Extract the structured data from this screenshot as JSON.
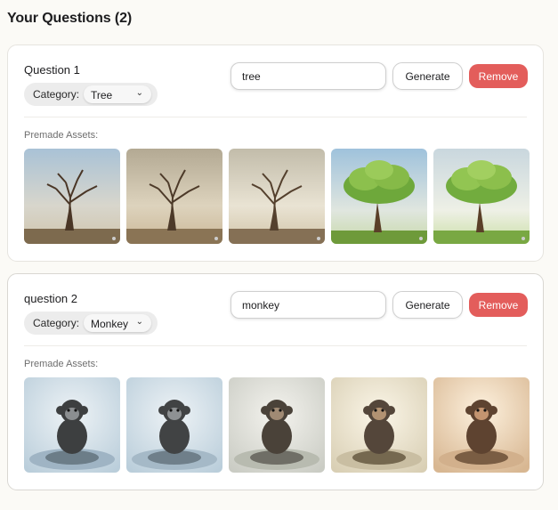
{
  "page": {
    "title": "Your Questions (2)"
  },
  "questions": [
    {
      "title": "Question 1",
      "category_label": "Category:",
      "category_value": "Tree",
      "prompt_value": "tree",
      "generate_label": "Generate",
      "remove_label": "Remove",
      "assets_label": "Premade Assets:",
      "assets": [
        {
          "name": "bare-tree-blue-sky"
        },
        {
          "name": "bare-tree-sepia"
        },
        {
          "name": "bare-tree-light"
        },
        {
          "name": "green-tree-blue-sky"
        },
        {
          "name": "green-tree-bright"
        }
      ]
    },
    {
      "title": "question 2",
      "category_label": "Category:",
      "category_value": "Monkey",
      "prompt_value": "monkey",
      "generate_label": "Generate",
      "remove_label": "Remove",
      "assets_label": "Premade Assets:",
      "assets": [
        {
          "name": "monkey-blue"
        },
        {
          "name": "monkey-blue-light"
        },
        {
          "name": "monkey-neutral"
        },
        {
          "name": "monkey-warm"
        },
        {
          "name": "monkey-sepia"
        }
      ]
    }
  ],
  "icons": {
    "category_chevron": "chevron-down-icon"
  },
  "colors": {
    "remove_button": "#e35d5b",
    "page_background": "#fbfaf6",
    "card_border": "#e6e4df"
  }
}
